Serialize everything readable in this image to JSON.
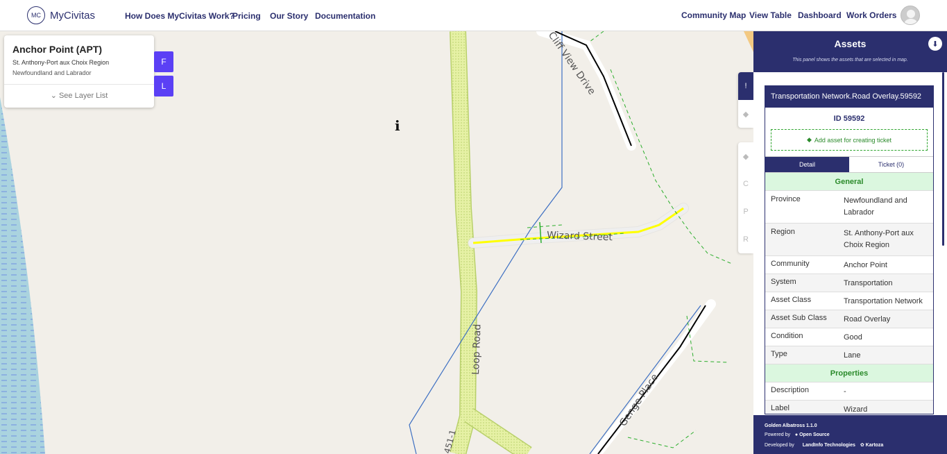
{
  "app": {
    "logo_text": "MC",
    "name": "MyCivitas"
  },
  "nav": {
    "left": [
      "How Does MyCivitas Work?",
      "Pricing",
      "Our Story",
      "Documentation"
    ],
    "right": [
      "Community Map",
      "View Table",
      "Dashboard",
      "Work Orders"
    ]
  },
  "location": {
    "title": "Anchor Point (APT)",
    "region": "St. Anthony-Port aux Choix Region",
    "province": "Newfoundland and Labrador",
    "layer_list": "See Layer List"
  },
  "map_buttons": {
    "f": "F",
    "l": "L"
  },
  "map_labels": {
    "loop_road": "Loop Road",
    "wizard_street": "Wizard Street",
    "genge_place": "Genge Place",
    "view_drive": "Cliff View Drive",
    "route": "451-1"
  },
  "side_tabs": [
    "!",
    "◆",
    "◆",
    "C",
    "P",
    "R"
  ],
  "panel": {
    "title": "Assets",
    "note": "This panel shows the assets that are selected in map.",
    "asset_header": "Transportation Network.Road Overlay.59592",
    "asset_id": "ID 59592",
    "add_asset": "Add asset for creating ticket",
    "tab_detail": "Detail",
    "tab_ticket": "Ticket (0)",
    "section_general": "General",
    "general": [
      {
        "k": "Province",
        "v": "Newfoundland and Labrador"
      },
      {
        "k": "Region",
        "v": "St. Anthony-Port aux Choix Region"
      },
      {
        "k": "Community",
        "v": "Anchor Point"
      },
      {
        "k": "System",
        "v": "Transportation"
      },
      {
        "k": "Asset Class",
        "v": "Transportation Network"
      },
      {
        "k": "Asset Sub Class",
        "v": "Road Overlay"
      },
      {
        "k": "Condition",
        "v": "Good"
      },
      {
        "k": "Type",
        "v": "Lane"
      }
    ],
    "section_properties": "Properties",
    "properties": [
      {
        "k": "Description",
        "v": "-"
      },
      {
        "k": "Label",
        "v": "Wizard"
      }
    ]
  },
  "footer": {
    "version": "Golden Albatross 1.1.0",
    "powered": "Powered by",
    "opensource": "Open Source",
    "developed": "Developed by",
    "dev1": "LandInfo Technologies",
    "dev2": "Kartoza"
  },
  "colors": {
    "primary": "#2b2f6e",
    "accent_button": "#5b40f5",
    "highlight": "#ffff00",
    "green": "#2a8a2a"
  }
}
